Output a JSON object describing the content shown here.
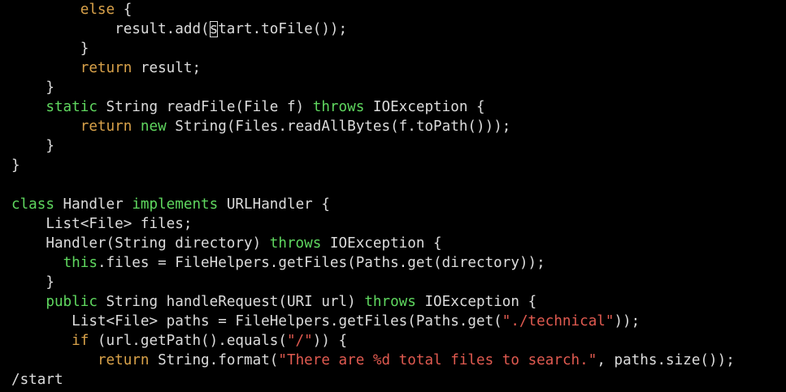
{
  "colors": {
    "background": "#000000",
    "text": "#dcdcdc",
    "keyword_orange": "#d9a24a",
    "keyword_green": "#5fd75f",
    "string": "#e05a50"
  },
  "code": {
    "l1": {
      "indent": "        ",
      "kw": "else",
      "rest": " {"
    },
    "l2": {
      "pre": "            result.add(",
      "cursor_char": "s",
      "post": "tart.toFile());"
    },
    "l3": {
      "text": "        }"
    },
    "l4": {
      "indent": "        ",
      "kw": "return",
      "rest": " result;"
    },
    "l5": {
      "text": "    }"
    },
    "l6": {
      "indent": "    ",
      "kw1": "static",
      "mid": " String readFile(File f) ",
      "kw2": "throws",
      "rest": " IOException {"
    },
    "l7": {
      "indent": "        ",
      "kw1": "return",
      "sp": " ",
      "kw2": "new",
      "rest": " String(Files.readAllBytes(f.toPath()));"
    },
    "l8": {
      "text": "    }"
    },
    "l9": {
      "text": "}"
    },
    "l10": {
      "text": ""
    },
    "l11": {
      "kw1": "class",
      "mid": " Handler ",
      "kw2": "implements",
      "rest": " URLHandler {"
    },
    "l12": {
      "text": "    List<File> files;"
    },
    "l13": {
      "pre": "    Handler(String directory) ",
      "kw": "throws",
      "rest": " IOException {"
    },
    "l14": {
      "indent": "      ",
      "kw": "this",
      "rest": ".files = FileHelpers.getFiles(Paths.get(directory));"
    },
    "l15": {
      "text": "    }"
    },
    "l16": {
      "indent": "    ",
      "kw1": "public",
      "mid": " String handleRequest(URI url) ",
      "kw2": "throws",
      "rest": " IOException {"
    },
    "l17": {
      "pre": "       List<File> paths = FileHelpers.getFiles(Paths.get(",
      "str": "\"./technical\"",
      "rest": "));"
    },
    "l18": {
      "indent": "       ",
      "kw": "if",
      "pre": " (url.getPath().equals(",
      "str": "\"/\"",
      "rest": ")) {"
    },
    "l19": {
      "indent": "          ",
      "kw": "return",
      "pre": " String.format(",
      "str": "\"There are %d total files to search.\"",
      "rest": ", paths.size());"
    }
  },
  "command_line": "/start"
}
